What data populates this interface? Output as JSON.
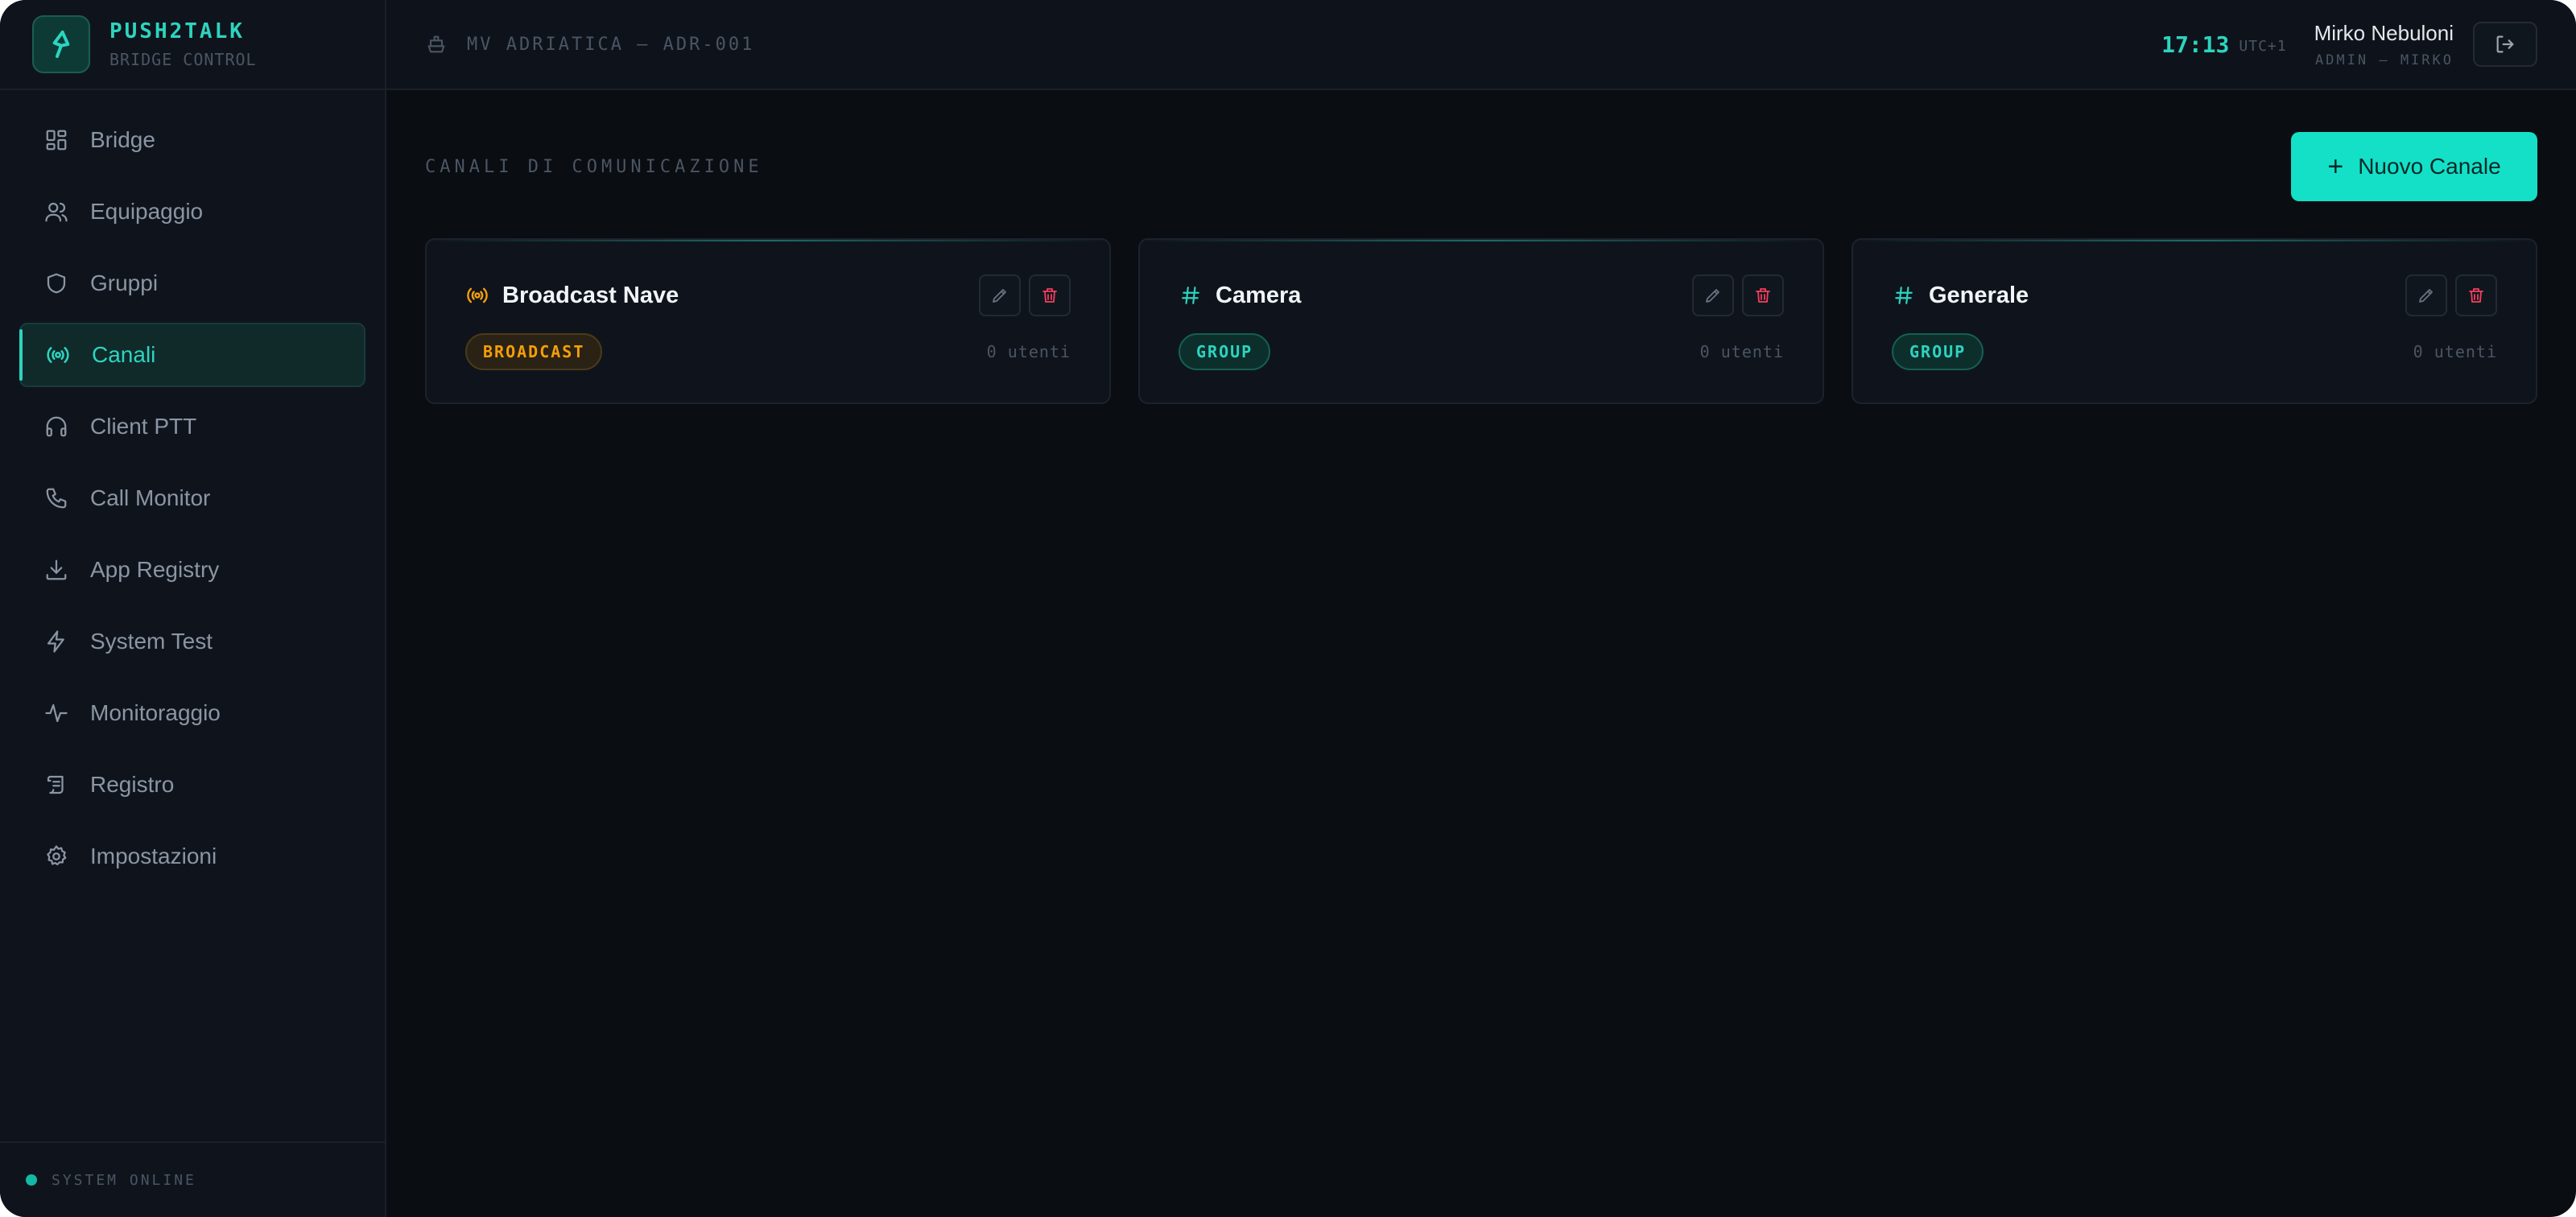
{
  "brand": {
    "title": "PUSH2TALK",
    "subtitle": "BRIDGE CONTROL"
  },
  "sidebar": {
    "items": [
      {
        "label": "Bridge",
        "icon": "dashboard-icon",
        "active": false
      },
      {
        "label": "Equipaggio",
        "icon": "users-icon",
        "active": false
      },
      {
        "label": "Gruppi",
        "icon": "shield-icon",
        "active": false
      },
      {
        "label": "Canali",
        "icon": "radio-icon",
        "active": true
      },
      {
        "label": "Client PTT",
        "icon": "headphones-icon",
        "active": false
      },
      {
        "label": "Call Monitor",
        "icon": "phone-icon",
        "active": false
      },
      {
        "label": "App Registry",
        "icon": "download-icon",
        "active": false
      },
      {
        "label": "System Test",
        "icon": "bolt-icon",
        "active": false
      },
      {
        "label": "Monitoraggio",
        "icon": "activity-icon",
        "active": false
      },
      {
        "label": "Registro",
        "icon": "scroll-icon",
        "active": false
      },
      {
        "label": "Impostazioni",
        "icon": "gear-icon",
        "active": false
      }
    ],
    "status": "SYSTEM ONLINE"
  },
  "header": {
    "vessel": "MV ADRIATICA — ADR-001",
    "time": "17:13",
    "timezone": "UTC+1",
    "user_name": "Mirko Nebuloni",
    "user_role": "ADMIN — MIRKO"
  },
  "main": {
    "section_title": "CANALI DI COMUNICAZIONE",
    "new_button": "Nuovo Canale",
    "channels": [
      {
        "name": "Broadcast Nave",
        "type": "BROADCAST",
        "users": "0 utenti",
        "icon": "radio-icon"
      },
      {
        "name": "Camera",
        "type": "GROUP",
        "users": "0 utenti",
        "icon": "hash-icon"
      },
      {
        "name": "Generale",
        "type": "GROUP",
        "users": "0 utenti",
        "icon": "hash-icon"
      }
    ]
  },
  "colors": {
    "accent": "#2dd4bf",
    "button": "#14e0c8",
    "broadcast": "#f59e0b",
    "danger": "#f43f5e",
    "background": "#0a0d12",
    "sidebar": "#0f141c"
  }
}
